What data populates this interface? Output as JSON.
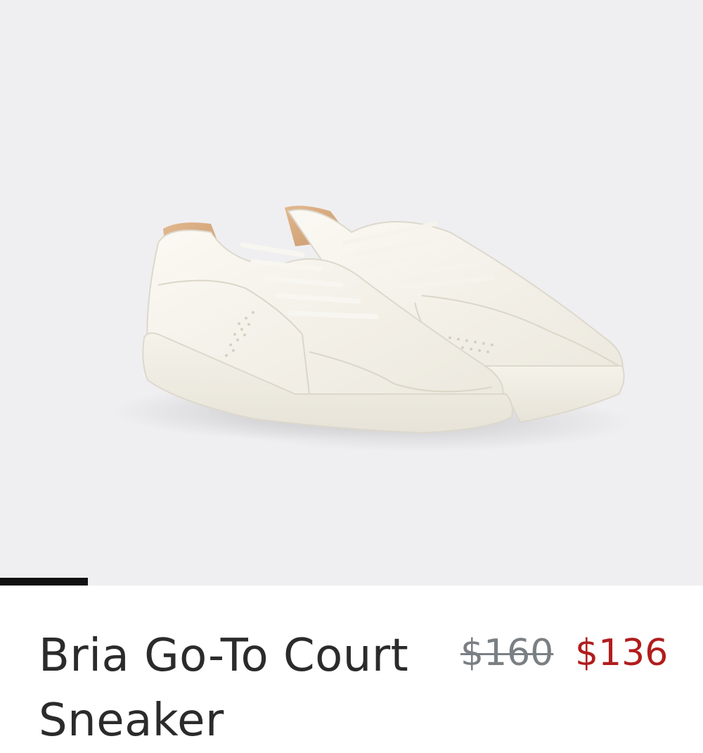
{
  "product": {
    "image_alt": "White leather court sneakers with tan heel tab",
    "title": "Bria Go-To Court Sneaker",
    "price_original": "$160",
    "price_sale": "$136"
  },
  "gallery": {
    "progress": 0.125
  },
  "colors": {
    "sale": "#b11d1d",
    "original": "#7a7f84",
    "background": "#efeff1"
  }
}
